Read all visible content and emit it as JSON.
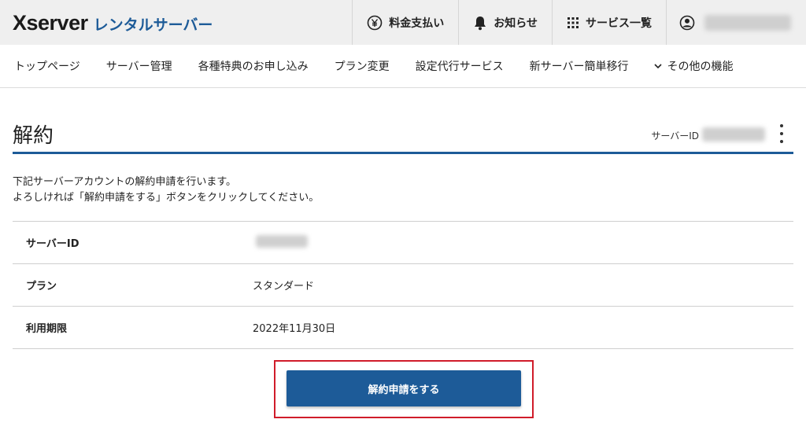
{
  "header": {
    "logo_main": "Xserver",
    "logo_sub": "レンタルサーバー",
    "actions": [
      {
        "label": "料金支払い",
        "icon": "yen-icon"
      },
      {
        "label": "お知らせ",
        "icon": "bell-icon"
      },
      {
        "label": "サービス一覧",
        "icon": "grid-icon"
      }
    ],
    "user_icon": "user-icon"
  },
  "nav": {
    "items": [
      "トップページ",
      "サーバー管理",
      "各種特典のお申し込み",
      "プラン変更",
      "設定代行サービス",
      "新サーバー簡単移行"
    ],
    "more_label": "その他の機能"
  },
  "page": {
    "title": "解約",
    "server_id_label": "サーバーID",
    "desc_line1": "下記サーバーアカウントの解約申請を行います。",
    "desc_line2": "よろしければ「解約申請をする」ボタンをクリックしてください。"
  },
  "table": {
    "rows": [
      {
        "label": "サーバーID",
        "value": ""
      },
      {
        "label": "プラン",
        "value": "スタンダード"
      },
      {
        "label": "利用期限",
        "value": "2022年11月30日"
      }
    ]
  },
  "actions": {
    "cancel_button_label": "解約申請をする"
  },
  "colors": {
    "brand_blue": "#1d5b98",
    "highlight_red": "#d01c2a"
  }
}
